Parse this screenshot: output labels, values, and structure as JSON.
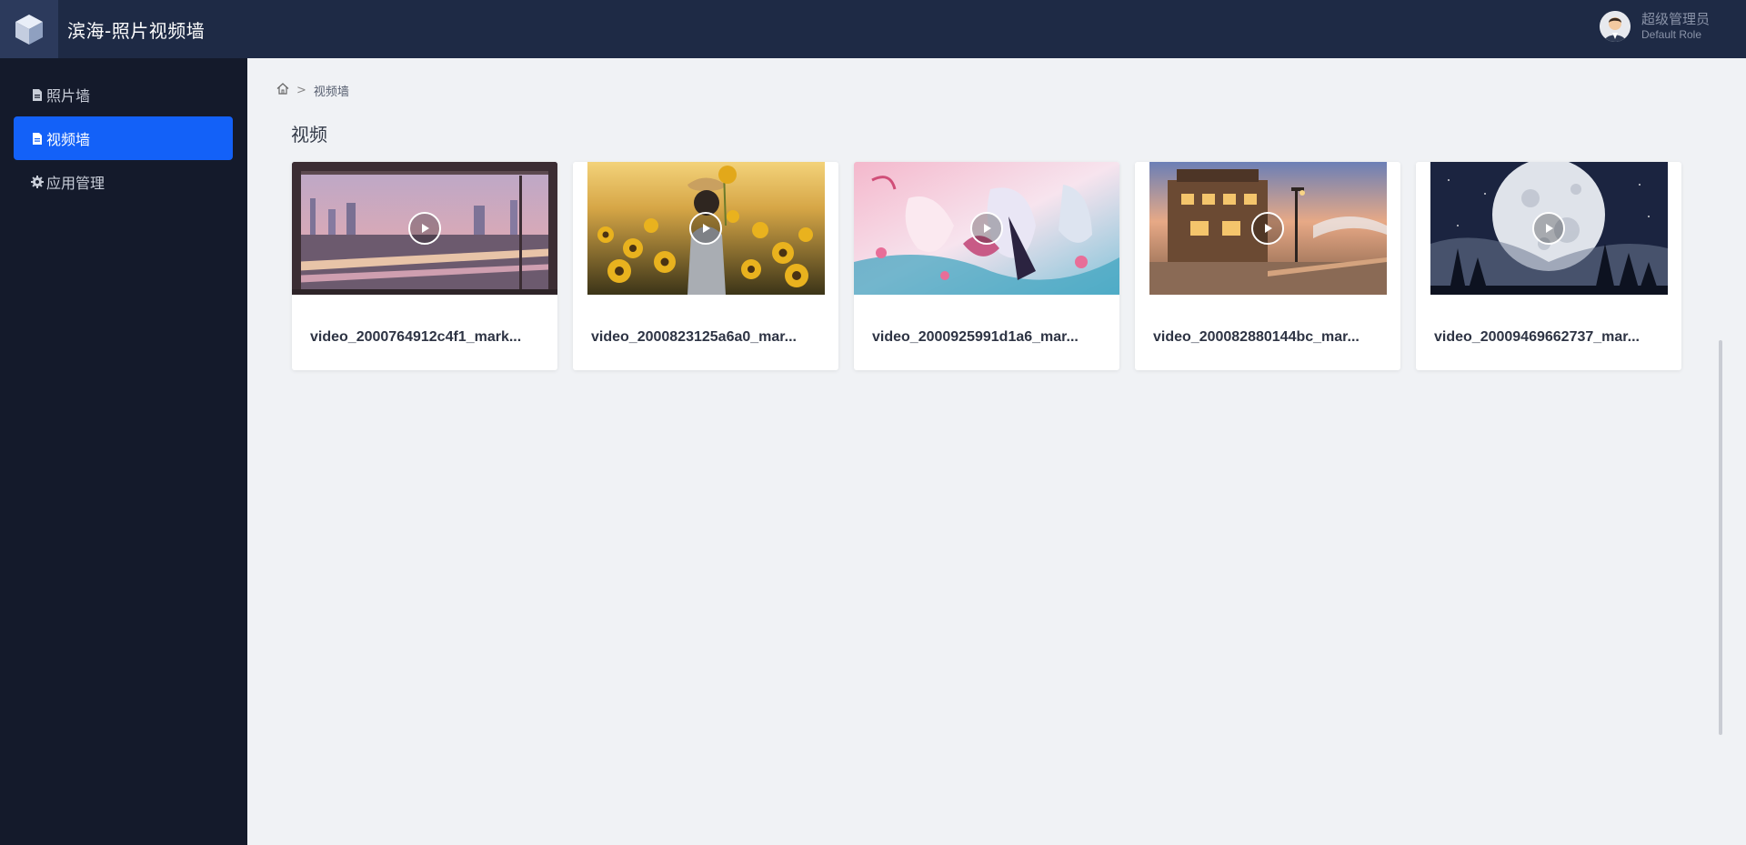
{
  "app": {
    "title": "滨海-照片视频墙"
  },
  "user": {
    "name": "超级管理员",
    "role": "Default Role"
  },
  "sidebar": {
    "items": [
      {
        "label": "照片墙",
        "icon": "file-icon",
        "active": false
      },
      {
        "label": "视频墙",
        "icon": "file-icon",
        "active": true
      },
      {
        "label": "应用管理",
        "icon": "gear-icon",
        "active": false
      }
    ]
  },
  "breadcrumb": {
    "separator": ">",
    "current": "视频墙"
  },
  "section": {
    "title": "视频"
  },
  "videos": [
    {
      "title": "video_2000764912c4f1_mark...",
      "scene": "city-window"
    },
    {
      "title": "video_2000823125a6a0_mar...",
      "scene": "sunflower-girl"
    },
    {
      "title": "video_2000925991d1a6_mar...",
      "scene": "anime-battle"
    },
    {
      "title": "video_200082880144bc_mar...",
      "scene": "sunset-street"
    },
    {
      "title": "video_20009469662737_mar...",
      "scene": "moon-night"
    }
  ],
  "colors": {
    "accent": "#1361f8",
    "header": "#1e2a45",
    "sidebar": "#141a2b"
  }
}
